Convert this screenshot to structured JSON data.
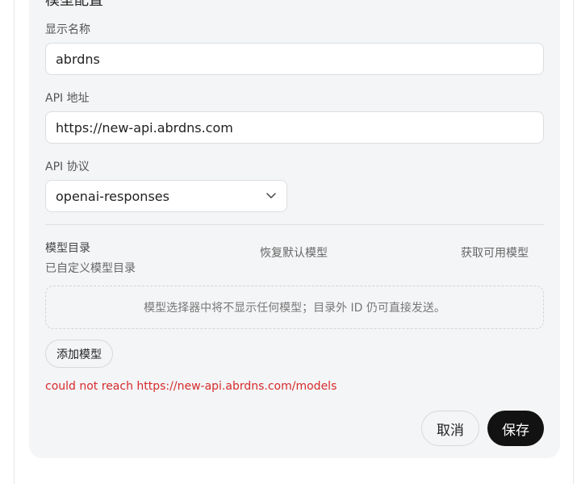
{
  "section": {
    "title": "模型配置"
  },
  "fields": {
    "display_name": {
      "label": "显示名称",
      "value": "abrdns"
    },
    "api_url": {
      "label": "API 地址",
      "value": "https://new-api.abrdns.com"
    },
    "api_protocol": {
      "label": "API 协议",
      "value": "openai-responses"
    }
  },
  "catalog": {
    "title": "模型目录",
    "subtitle": "已自定义模型目录",
    "restore_default": "恢复默认模型",
    "fetch_available": "获取可用模型",
    "empty_message": "模型选择器中将不显示任何模型；目录外 ID 仍可直接发送。",
    "add_model": "添加模型"
  },
  "error_message": "could not reach https://new-api.abrdns.com/models",
  "actions": {
    "cancel": "取消",
    "save": "保存"
  },
  "icons": {
    "select_chevron": "chevron-down-icon"
  },
  "colors": {
    "error": "#d72b2b",
    "primary_button": "#121212",
    "panel": "#f4f5f7"
  }
}
